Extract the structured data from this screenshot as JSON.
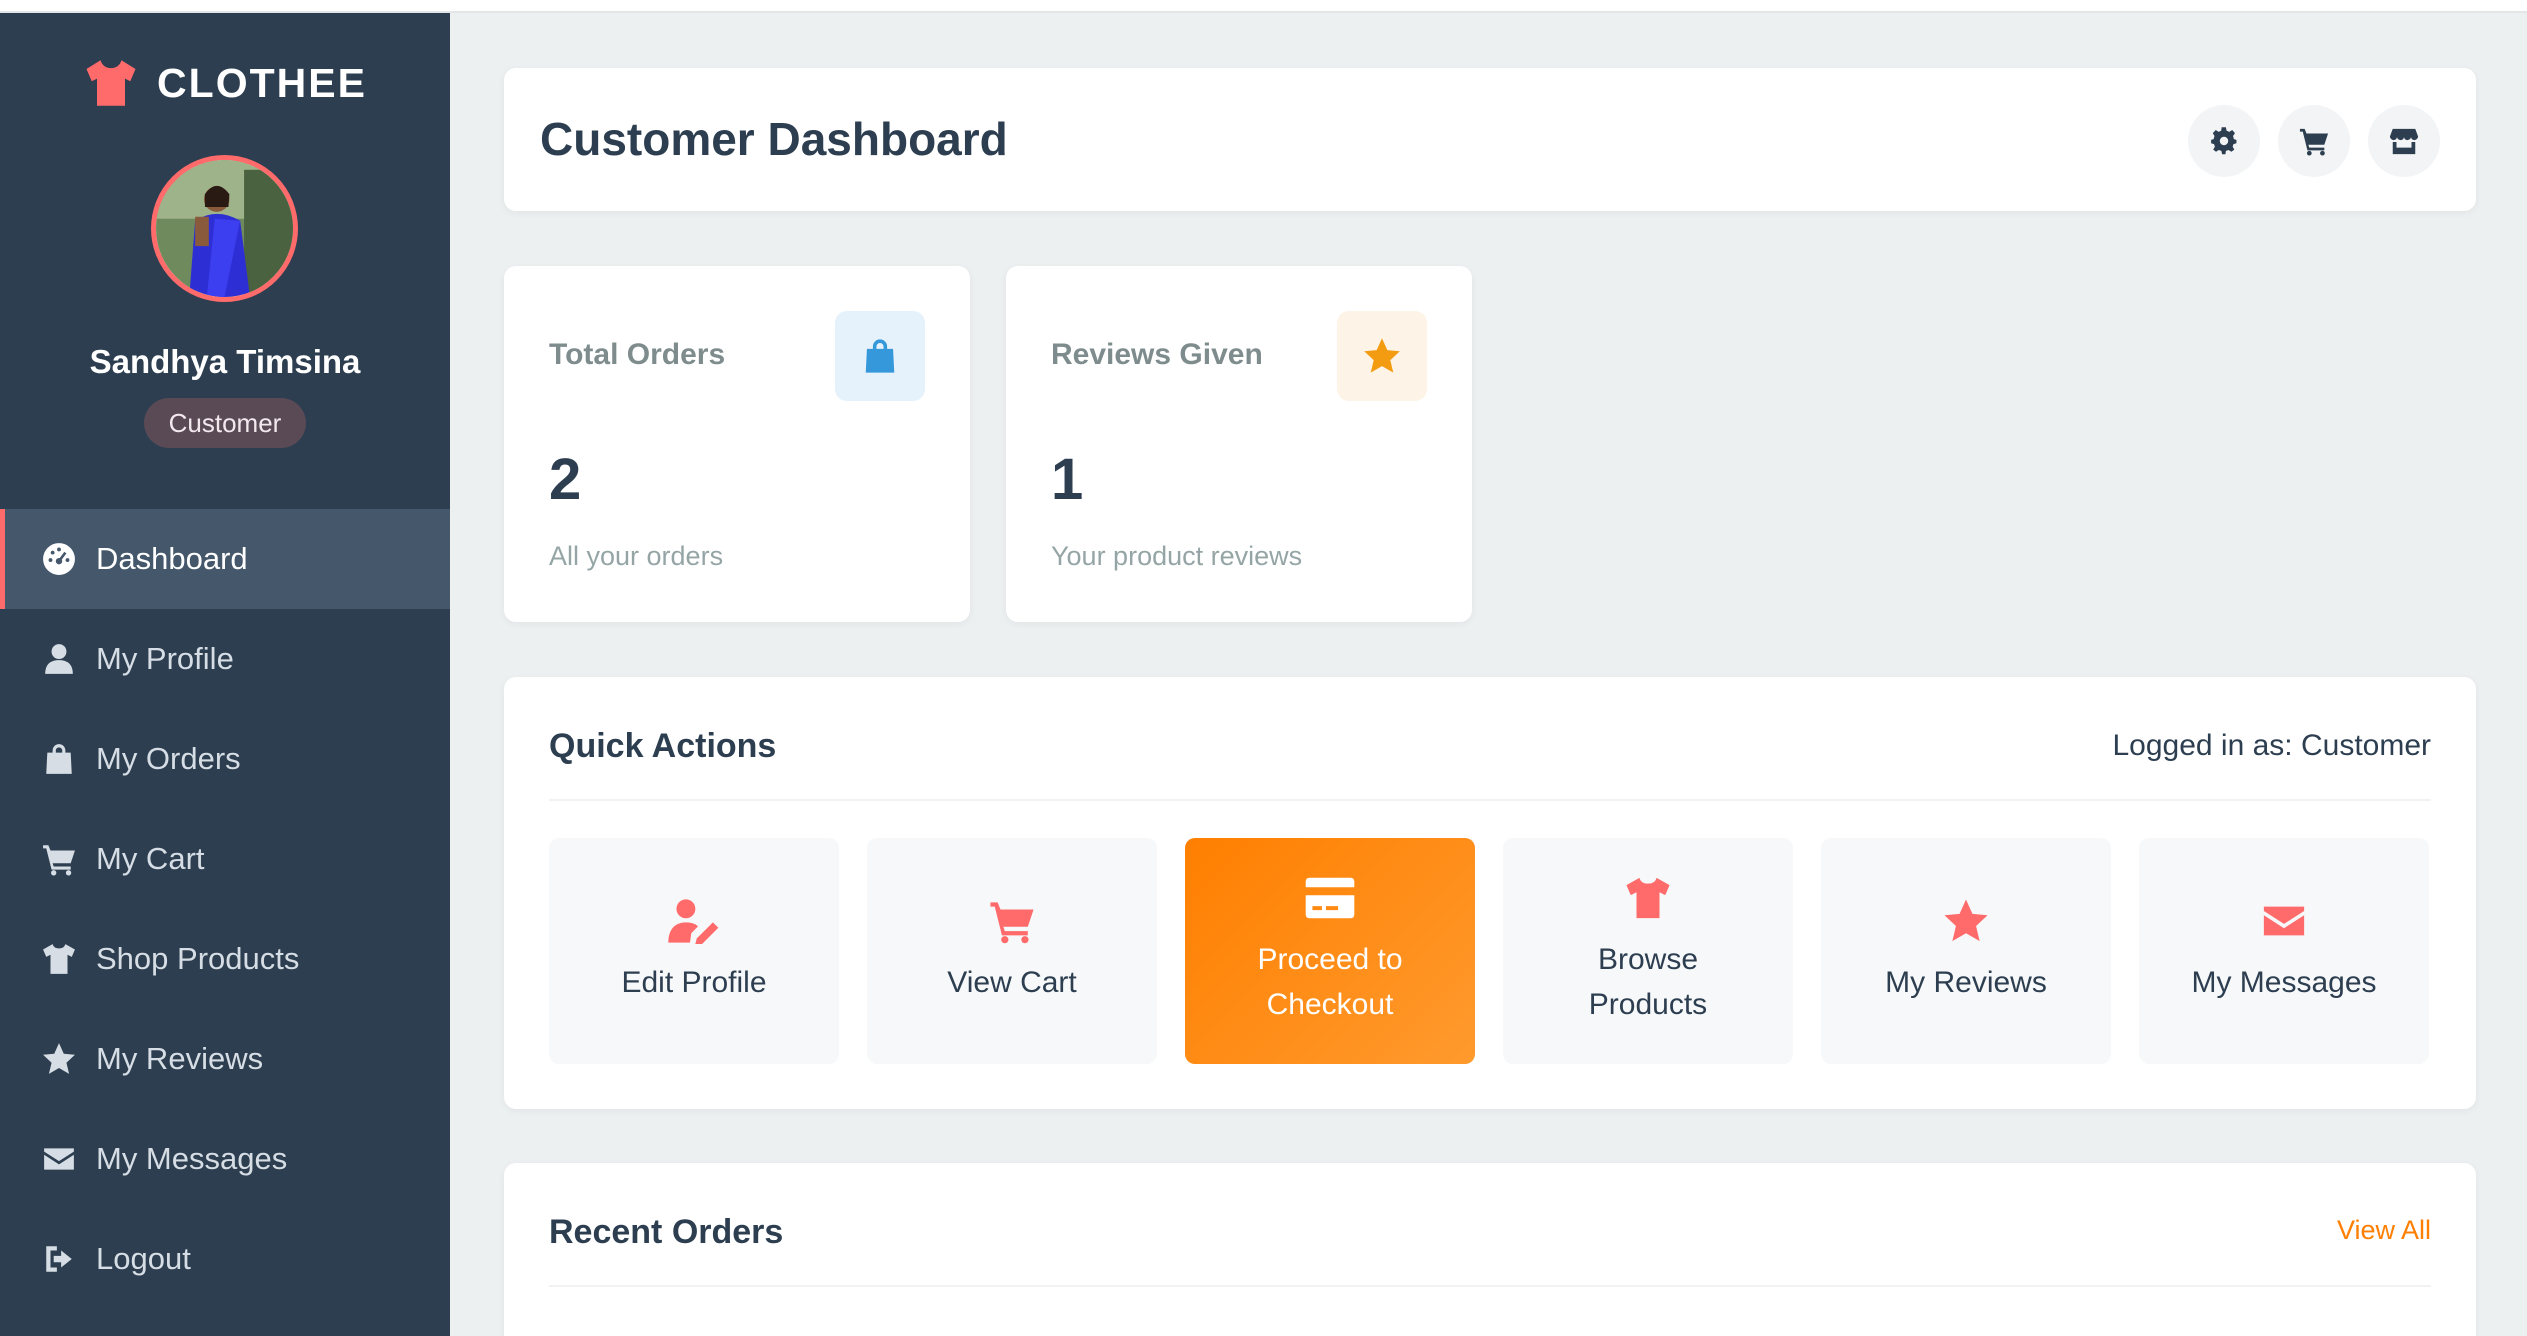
{
  "brand": {
    "name": "CLOTHEE",
    "icon": "tshirt-icon",
    "accent": "#ff6b6b"
  },
  "user": {
    "name": "Sandhya Timsina",
    "role": "Customer"
  },
  "sidebar": {
    "items": [
      {
        "label": "Dashboard",
        "icon": "gauge-icon",
        "active": true
      },
      {
        "label": "My Profile",
        "icon": "user-icon"
      },
      {
        "label": "My Orders",
        "icon": "bag-icon"
      },
      {
        "label": "My Cart",
        "icon": "cart-icon"
      },
      {
        "label": "Shop Products",
        "icon": "tshirt-icon"
      },
      {
        "label": "My Reviews",
        "icon": "star-icon"
      },
      {
        "label": "My Messages",
        "icon": "envelope-icon"
      },
      {
        "label": "Logout",
        "icon": "logout-icon"
      }
    ]
  },
  "header": {
    "title": "Customer Dashboard",
    "buttons": [
      "gear-icon",
      "cart-icon",
      "store-icon"
    ]
  },
  "stats": [
    {
      "label": "Total Orders",
      "value": "2",
      "sub": "All your orders",
      "icon": "bag-icon",
      "color": "#3498db"
    },
    {
      "label": "Reviews Given",
      "value": "1",
      "sub": "Your product reviews",
      "icon": "star-icon",
      "color": "#f39c12"
    }
  ],
  "quick_actions": {
    "title": "Quick Actions",
    "logged_in": "Logged in as: Customer",
    "items": [
      {
        "label": "Edit Profile",
        "icon": "user-edit-icon"
      },
      {
        "label": "View Cart",
        "icon": "cart-icon"
      },
      {
        "label": "Proceed to Checkout",
        "icon": "credit-card-icon",
        "highlight": "#ff7f00"
      },
      {
        "label": "Browse Products",
        "icon": "tshirt-icon"
      },
      {
        "label": "My Reviews",
        "icon": "star-icon"
      },
      {
        "label": "My Messages",
        "icon": "envelope-icon"
      }
    ]
  },
  "recent_orders": {
    "title": "Recent Orders",
    "view_all": "View All"
  }
}
